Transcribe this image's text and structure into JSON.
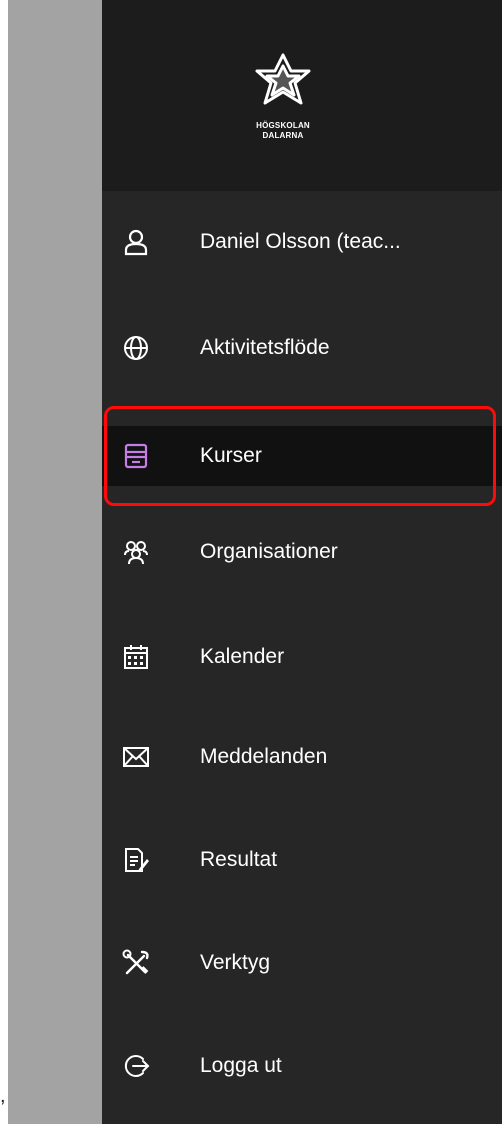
{
  "brand": {
    "line1": "HÖGSKOLAN",
    "line2": "DALARNA"
  },
  "menu": {
    "items": [
      {
        "label": "Daniel Olsson (teac...",
        "icon": "user-icon"
      },
      {
        "label": "Aktivitetsflöde",
        "icon": "globe-icon"
      },
      {
        "label": "Kurser",
        "icon": "courses-icon",
        "active": true
      },
      {
        "label": "Organisationer",
        "icon": "organizations-icon"
      },
      {
        "label": "Kalender",
        "icon": "calendar-icon"
      },
      {
        "label": "Meddelanden",
        "icon": "envelope-icon"
      },
      {
        "label": "Resultat",
        "icon": "grades-icon"
      },
      {
        "label": "Verktyg",
        "icon": "tools-icon"
      },
      {
        "label": "Logga ut",
        "icon": "logout-icon"
      }
    ]
  },
  "colors": {
    "sidebar": "#262626",
    "brand_bg": "#1c1c1c",
    "active_icon": "#c47ee6",
    "highlight": "#ff0a0a"
  },
  "caption_mark": ","
}
